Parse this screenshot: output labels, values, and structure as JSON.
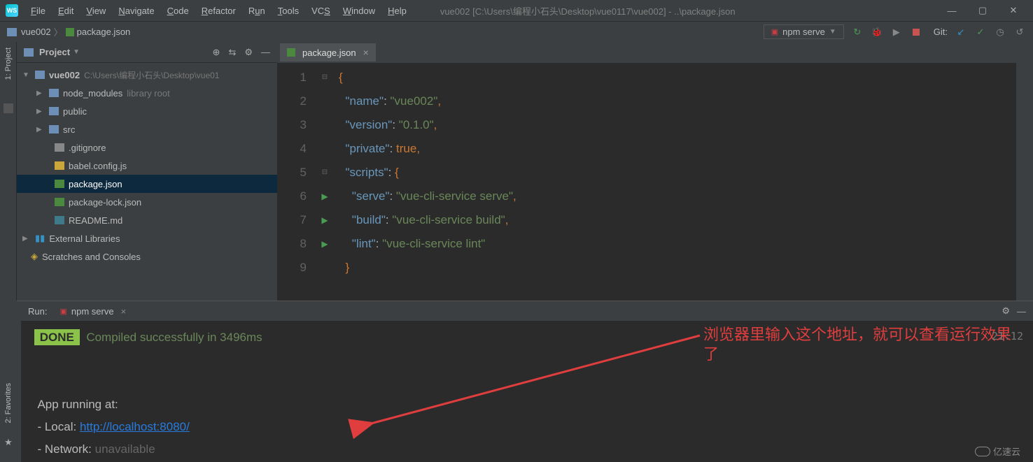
{
  "menu": {
    "file": "File",
    "edit": "Edit",
    "view": "View",
    "navigate": "Navigate",
    "code": "Code",
    "refactor": "Refactor",
    "run": "Run",
    "tools": "Tools",
    "vcs": "VCS",
    "window": "Window",
    "help": "Help"
  },
  "window_title": "vue002 [C:\\Users\\编程小石头\\Desktop\\vue0117\\vue002] - ..\\package.json",
  "breadcrumb": {
    "root": "vue002",
    "file": "package.json"
  },
  "run_config": {
    "name": "npm serve"
  },
  "git_label": "Git:",
  "project": {
    "label": "Project",
    "root_name": "vue002",
    "root_path": "C:\\Users\\编程小石头\\Desktop\\vue01",
    "node_modules": "node_modules",
    "node_modules_hint": "library root",
    "public": "public",
    "src": "src",
    "gitignore": ".gitignore",
    "babel": "babel.config.js",
    "package": "package.json",
    "package_lock": "package-lock.json",
    "readme": "README.md",
    "ext_lib": "External Libraries",
    "scratches": "Scratches and Consoles"
  },
  "editor": {
    "tab": "package.json",
    "lines": {
      "l1": "{",
      "k_name": "\"name\"",
      "v_name": "\"vue002\"",
      "k_version": "\"version\"",
      "v_version": "\"0.1.0\"",
      "k_private": "\"private\"",
      "v_private": "true",
      "k_scripts": "\"scripts\"",
      "k_serve": "\"serve\"",
      "v_serve": "\"vue-cli-service serve\"",
      "k_build": "\"build\"",
      "v_build": "\"vue-cli-service build\"",
      "k_lint": "\"lint\"",
      "v_lint": "\"vue-cli-service lint\"",
      "l9": "}"
    }
  },
  "run_panel": {
    "label": "Run:",
    "tab": "npm serve",
    "done": "DONE",
    "msg": "Compiled successfully in 3496ms",
    "app_running": "App running at:",
    "local_label": "- Local:   ",
    "local_url": "http://localhost:8080/",
    "net_label": "- Network: ",
    "net_val": "unavailable",
    "timestamp": "21:12"
  },
  "annotation": "浏览器里输入这个地址，就可以查看运行效果了",
  "watermark": "亿速云",
  "fav_label": "2: Favorites",
  "proj_label": "1: Project"
}
